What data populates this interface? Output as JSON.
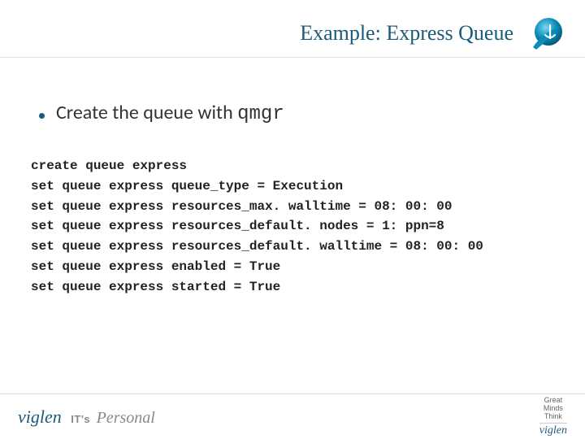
{
  "header": {
    "title": "Example: Express Queue"
  },
  "bullets": [
    {
      "prefix": "Create the queue with ",
      "code": "qmgr"
    }
  ],
  "code_lines": [
    "create queue express",
    "set queue express queue_type = Execution",
    "set queue express resources_max. walltime = 08: 00: 00",
    "set queue express resources_default. nodes = 1: ppn=8",
    "set queue express resources_default. walltime = 08: 00: 00",
    "set queue express enabled = True",
    "set queue express started = True"
  ],
  "footer": {
    "brand": "viglen",
    "its": "IT's",
    "personal": "Personal",
    "tagline1": "Great",
    "tagline2": "Minds",
    "tagline3": "Think",
    "brand_small": "viglen"
  }
}
